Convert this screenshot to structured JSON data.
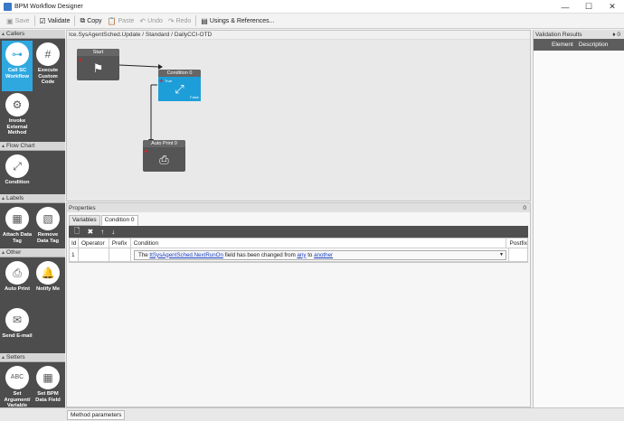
{
  "window": {
    "title": "BPM Workflow Designer",
    "minimize": "—",
    "maximize": "☐",
    "close": "✕"
  },
  "toolbar": {
    "save": "Save",
    "validate": "Validate",
    "copy": "Copy",
    "paste": "Paste",
    "undo": "Undo",
    "redo": "Redo",
    "usings": "Usings & References..."
  },
  "sidebar": {
    "callers": {
      "title": "Callers",
      "items": [
        "Call SC Workflow",
        "Execute Custom Code",
        "Invoke External Method"
      ]
    },
    "flowchart": {
      "title": "Flow Chart",
      "items": [
        "Condition"
      ]
    },
    "labels": {
      "title": "Labels",
      "items": [
        "Attach Data Tag",
        "Remove Data Tag"
      ]
    },
    "other": {
      "title": "Other",
      "items": [
        "Auto Print",
        "Notify Me",
        "Send E-mail"
      ]
    },
    "setters": {
      "title": "Setters",
      "items": [
        "Set Argument/ Variable",
        "Set BPM Data Field"
      ]
    }
  },
  "canvas": {
    "breadcrumb": "Ice.SysAgentSched.Update / Standard / DailyCCI-OTD",
    "nodes": {
      "start": "Start",
      "condition": "Condition 0",
      "autoprint": "Auto Print 0",
      "true_label": "True",
      "false_label": "False"
    }
  },
  "validation": {
    "title": "Validation Results",
    "pin": "♦ 0",
    "col_element": "Element",
    "col_description": "Description"
  },
  "properties": {
    "title": "Properties",
    "pin": "0",
    "tabs": [
      "Variables",
      "Condition 0"
    ],
    "columns": {
      "id": "Id",
      "operator": "Operator",
      "prefix": "Prefix",
      "condition": "Condition",
      "postfix": "Postfix"
    },
    "rows": [
      {
        "id": "1",
        "operator": "",
        "prefix": "",
        "postfix": "",
        "cond_the": "The",
        "cond_field": "ttSysAgentSched.NextRunOn",
        "cond_mid": "field has been changed from",
        "cond_from": "any",
        "cond_to_word": "to",
        "cond_to": "another"
      }
    ]
  },
  "bottom": {
    "tab": "Method parameters"
  },
  "colors": {
    "accent": "#2fa8e0",
    "panel_dark": "#4d4d4d",
    "link": "#1a3fc0"
  }
}
